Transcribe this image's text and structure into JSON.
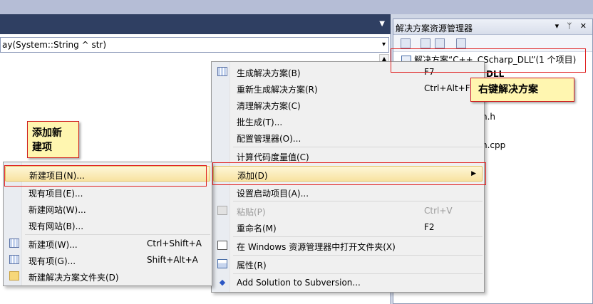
{
  "editor": {
    "signature": "ay(System::String ^ str)"
  },
  "solution_explorer": {
    "title": "解决方案资源管理器",
    "window_buttons": "▾ ᛘ ✕",
    "solution_node": "解决方案“C++_CScharp_DLL”(1 个项目)",
    "project_fragment": "DLL",
    "file1_fragment": "n.h",
    "file2_fragment": "n.cpp"
  },
  "main_menu": {
    "items": [
      {
        "label": "生成解决方案(B)",
        "shortcut": "F7",
        "icon": "build-icon"
      },
      {
        "label": "重新生成解决方案(R)",
        "shortcut": "Ctrl+Alt+F7"
      },
      {
        "label": "清理解决方案(C)",
        "shortcut": ""
      },
      {
        "label": "批生成(T)...",
        "shortcut": ""
      },
      {
        "label": "配置管理器(O)...",
        "shortcut": ""
      },
      {
        "label": "计算代码度量值(C)",
        "shortcut": ""
      },
      {
        "label": "添加(D)",
        "shortcut": ""
      },
      {
        "label": "设置启动项目(A)...",
        "shortcut": ""
      },
      {
        "label": "粘贴(P)",
        "shortcut": "Ctrl+V",
        "disabled": true
      },
      {
        "label": "重命名(M)",
        "shortcut": "F2"
      },
      {
        "label": "在 Windows 资源管理器中打开文件夹(X)",
        "shortcut": ""
      },
      {
        "label": "属性(R)",
        "shortcut": ""
      },
      {
        "label": "Add Solution to Subversion...",
        "shortcut": ""
      }
    ],
    "submenu_arrow": "▶"
  },
  "sub_menu": {
    "items": [
      {
        "label": "新建项目(N)...",
        "shortcut": ""
      },
      {
        "label": "现有项目(E)...",
        "shortcut": ""
      },
      {
        "label": "新建网站(W)...",
        "shortcut": ""
      },
      {
        "label": "现有网站(B)...",
        "shortcut": ""
      },
      {
        "label": "新建项(W)...",
        "shortcut": "Ctrl+Shift+A"
      },
      {
        "label": "现有项(G)...",
        "shortcut": "Shift+Alt+A"
      },
      {
        "label": "新建解决方案文件夹(D)",
        "shortcut": ""
      }
    ]
  },
  "callouts": {
    "right_click": "右键解决方案",
    "add_new_line1": "添加新",
    "add_new_line2": "建项"
  }
}
